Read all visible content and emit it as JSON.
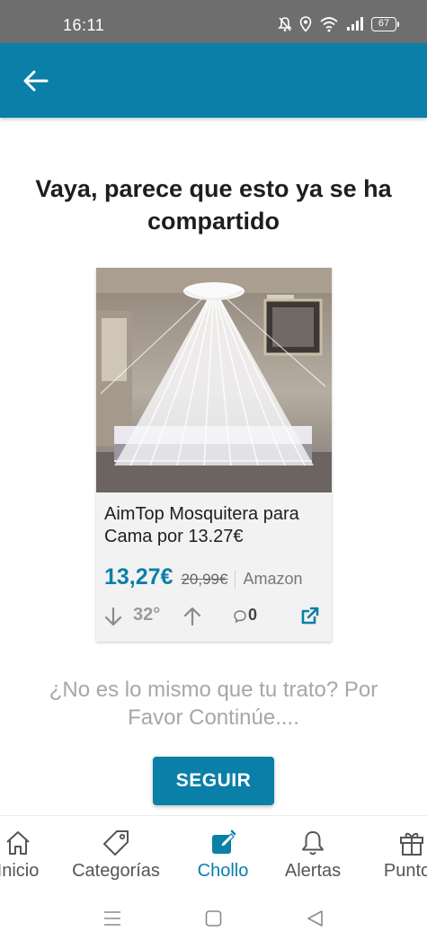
{
  "status_bar": {
    "time": "16:11",
    "battery": "67",
    "icons": [
      "mute-icon",
      "location-icon",
      "wifi-icon",
      "signal-icon",
      "battery-icon"
    ]
  },
  "app_bar": {
    "back_icon": "arrow-left-icon",
    "color": "#0a7fa8"
  },
  "headline": "Vaya, parece que esto ya se ha compartido",
  "deal_card": {
    "image": "mosquito-net-over-bed-photo",
    "title": "AimTop Mosquitera para Cama por 13.27€",
    "price": "13,27€",
    "old_price": "20,99€",
    "merchant": "Amazon",
    "temperature": "32°",
    "comments": "0"
  },
  "question": "¿No es lo mismo que tu trato? Por Favor Continúe....",
  "continue_button": "SEGUIR",
  "bottom_nav": {
    "items": [
      {
        "label": "Inicio",
        "icon": "home-icon",
        "active": false
      },
      {
        "label": "Categorías",
        "icon": "tag-icon",
        "active": false
      },
      {
        "label": "Chollo",
        "icon": "edit-icon",
        "active": true
      },
      {
        "label": "Alertas",
        "icon": "bell-icon",
        "active": false
      },
      {
        "label": "Puntos",
        "icon": "gift-icon",
        "active": false
      }
    ]
  },
  "system_nav": [
    "menu-icon",
    "home-square-icon",
    "back-triangle-icon"
  ],
  "colors": {
    "accent": "#0a7fa8",
    "status_bar": "#6e6e6e"
  }
}
